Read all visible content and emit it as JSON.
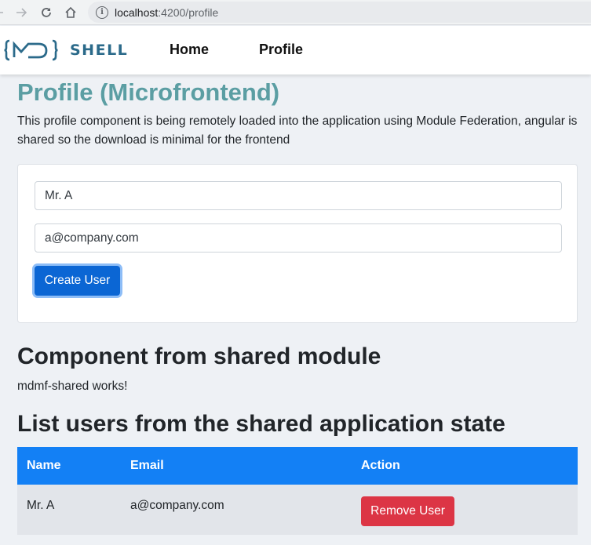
{
  "browser": {
    "url_host": "localhost",
    "url_path": ":4200/profile",
    "info_icon": "i"
  },
  "navbar": {
    "logo_text": "SHELL",
    "links": [
      {
        "label": "Home"
      },
      {
        "label": "Profile"
      }
    ]
  },
  "page": {
    "title": "Profile (Microfrontend)",
    "intro": "This profile component is being remotely loaded into the application using Module Federation, angular is shared so the download is minimal for the frontend"
  },
  "form": {
    "name_value": "Mr. A",
    "email_value": "a@company.com",
    "create_label": "Create User"
  },
  "shared": {
    "heading": "Component from shared module",
    "text": "mdmf-shared works!"
  },
  "users": {
    "heading": "List users from the shared application state",
    "columns": [
      "Name",
      "Email",
      "Action"
    ],
    "rows": [
      {
        "name": "Mr. A",
        "email": "a@company.com",
        "action_label": "Remove User"
      }
    ]
  },
  "colors": {
    "brand": "#2b6a8a",
    "title": "#5b9ea3",
    "primary": "#0b66d4",
    "table_header": "#1380f5",
    "danger": "#dc3545"
  }
}
